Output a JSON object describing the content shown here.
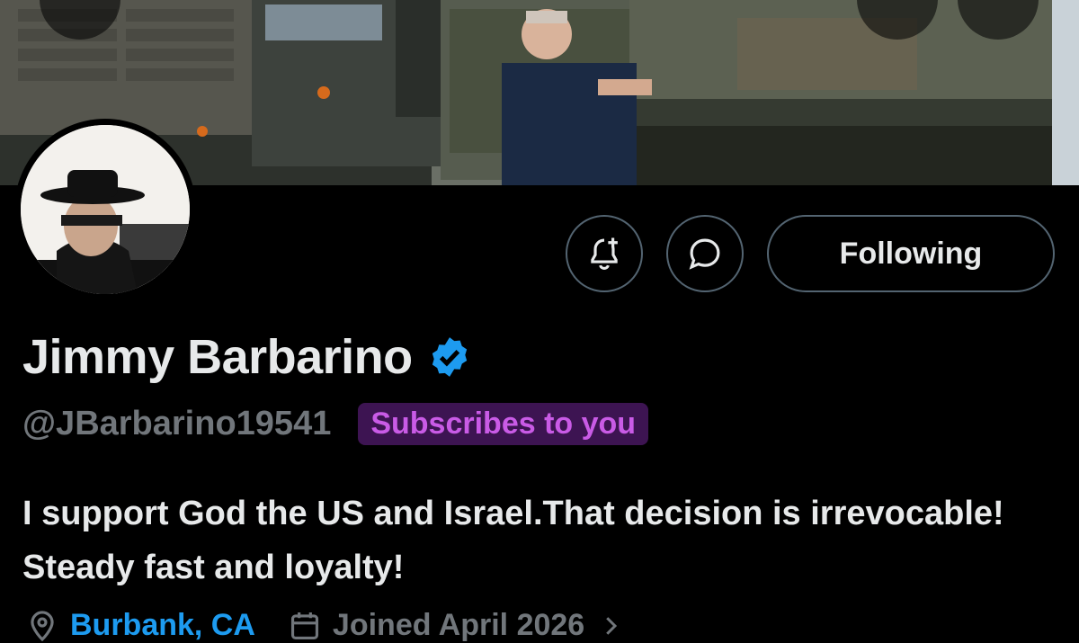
{
  "profile": {
    "name": "Jimmy Barbarino",
    "handle": "@JBarbarino19541",
    "subscription_badge": "Subscribes to you",
    "bio": "I support God the US and Israel.That decision is irrevocable! Steady fast and loyalty!",
    "location": "Burbank, CA",
    "joined": "Joined April 2026",
    "verified": true
  },
  "actions": {
    "follow_label": "Following"
  },
  "icons": {
    "back": "arrow-left-icon",
    "search": "search-icon",
    "more": "more-icon",
    "notify": "bell-plus-icon",
    "message": "chat-bubble-icon",
    "verified": "verified-badge-icon",
    "location": "location-pin-icon",
    "calendar": "calendar-icon",
    "chevron": "chevron-right-icon"
  },
  "colors": {
    "background": "#000000",
    "text": "#e7e9ea",
    "muted": "#71767b",
    "accent_blue": "#1d9bf0",
    "badge_bg": "#3d1452",
    "badge_text": "#c95be6"
  }
}
